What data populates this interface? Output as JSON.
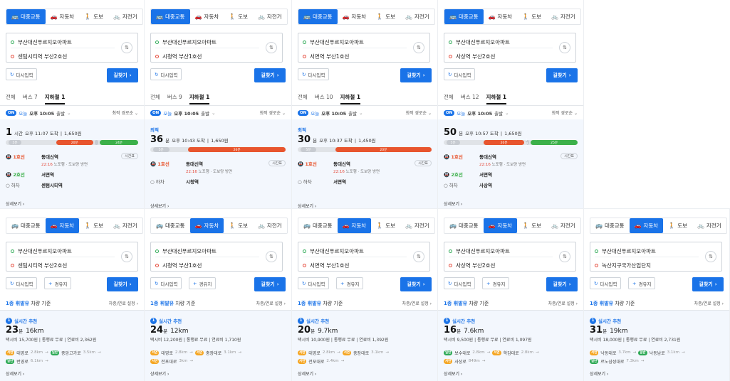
{
  "labels": {
    "tab_transit": "대중교통",
    "tab_car": "자동차",
    "tab_walk": "도보",
    "tab_bike": "자전거",
    "reset": "다시입력",
    "waypoint": "경유지",
    "go": "길찾기",
    "on": "ON",
    "dep_today": "오늘",
    "dep_time": "오후 10:05",
    "dep_suffix": "출발",
    "sort": "최적 경로순",
    "detail": "상세보기",
    "best": "최적",
    "timetable": "시간표",
    "alight": "하차",
    "car_prefix": "1종 휘발유",
    "car_suffix": "차량 기준",
    "car_setting": "차종/연료 설정",
    "realtime": "실시간 추천"
  },
  "origin": "부산대신푸르지오아파트",
  "transit": [
    {
      "dest": "센텀시티역 부산2호선",
      "sub_all": "전체",
      "sub_bus": "버스 7",
      "sub_sub": "지하철 1",
      "best": false,
      "time_num": "1",
      "time_unit": "시간",
      "arrive": "오후 11:07 도착",
      "fare": "1,650원",
      "leg1_line": "1호선",
      "leg1_station": "동대신역",
      "leg1_info": "22:16",
      "leg1_info2": "노포행 · 도보양 방면",
      "leg2_line": "2호선",
      "leg2_station": "서면역",
      "alight_station": "센텀시티역",
      "segs": [
        {
          "l": 0.02,
          "w": 0.1,
          "c": "#c7cbd1",
          "t": "5분"
        },
        {
          "l": 0.38,
          "w": 0.28,
          "c": "#e8552e",
          "t": "20분"
        },
        {
          "l": 0.67,
          "w": 0.03,
          "c": "#c7cbd1",
          "t": ""
        },
        {
          "l": 0.71,
          "w": 0.29,
          "c": "#3cb04a",
          "t": "24분"
        }
      ]
    },
    {
      "dest": "시청역 부산1호선",
      "sub_all": "전체",
      "sub_bus": "버스 9",
      "sub_sub": "지하철 1",
      "best": true,
      "time_num": "36",
      "time_unit": "분",
      "arrive": "오후 10:43 도착",
      "fare": "1,650원",
      "leg1_line": "1호선",
      "leg1_station": "동대신역",
      "leg1_info": "22:16",
      "leg1_info2": "노포행 · 도보양 방면",
      "leg2_line": "",
      "leg2_station": "",
      "alight_station": "시청역",
      "segs": [
        {
          "l": 0.02,
          "w": 0.12,
          "c": "#c7cbd1",
          "t": "5분"
        },
        {
          "l": 0.28,
          "w": 0.72,
          "c": "#e8552e",
          "t": "26분"
        }
      ]
    },
    {
      "dest": "서면역 부산1호선",
      "sub_all": "전체",
      "sub_bus": "버스 10",
      "sub_sub": "지하철 1",
      "best": true,
      "time_num": "30",
      "time_unit": "분",
      "arrive": "오후 10:37 도착",
      "fare": "1,450원",
      "leg1_line": "1호선",
      "leg1_station": "동대신역",
      "leg1_info": "22:16",
      "leg1_info2": "노포행 · 도보양 방면",
      "leg2_line": "",
      "leg2_station": "",
      "alight_station": "서면역",
      "segs": [
        {
          "l": 0.02,
          "w": 0.12,
          "c": "#c7cbd1",
          "t": "5분"
        },
        {
          "l": 0.28,
          "w": 0.72,
          "c": "#e8552e",
          "t": "20분"
        }
      ]
    },
    {
      "dest": "사상역 부산2호선",
      "sub_all": "전체",
      "sub_bus": "버스 12",
      "sub_sub": "지하철 1",
      "best": false,
      "time_num": "50",
      "time_unit": "분",
      "arrive": "오후 10:57 도착",
      "fare": "1,650원",
      "leg1_line": "1호선",
      "leg1_station": "동대신역",
      "leg1_info": "22:16",
      "leg1_info2": "노포행 · 도보양 방면",
      "leg2_line": "2호선",
      "leg2_station": "서면역",
      "alight_station": "사상역",
      "segs": [
        {
          "l": 0.02,
          "w": 0.1,
          "c": "#c7cbd1",
          "t": "5분"
        },
        {
          "l": 0.3,
          "w": 0.3,
          "c": "#e8552e",
          "t": "20분"
        },
        {
          "l": 0.61,
          "w": 0.03,
          "c": "#c7cbd1",
          "t": "1분"
        },
        {
          "l": 0.65,
          "w": 0.35,
          "c": "#3cb04a",
          "t": "25분"
        }
      ]
    }
  ],
  "car": [
    {
      "dest": "센텀시티역 부산2호선",
      "time_num": "23",
      "time_unit": "분",
      "km": "16km",
      "taxi": "택시비 15,700원",
      "toll": "통행료 무료",
      "fuel": "연료비 2,362원",
      "roads": [
        [
          {
            "b": "y",
            "t": "서면",
            "n": "대영로",
            "d": "2.8km"
          },
          {
            "b": "g",
            "t": "일반",
            "n": "중앙고가로",
            "d": "3.5km"
          }
        ],
        [
          {
            "b": "g",
            "t": "일반",
            "n": "번영로",
            "d": "6.1km"
          }
        ]
      ]
    },
    {
      "dest": "시청역 부산1호선",
      "time_num": "24",
      "time_unit": "분",
      "km": "12km",
      "taxi": "택시비 12,200원",
      "toll": "통행료 무료",
      "fuel": "연료비 1,710원",
      "roads": [
        [
          {
            "b": "y",
            "t": "서면",
            "n": "대영로",
            "d": "2.8km"
          },
          {
            "b": "y",
            "t": "서면",
            "n": "충장대로",
            "d": "3.1km"
          }
        ],
        [
          {
            "b": "y",
            "t": "서면",
            "n": "전포대로",
            "d": "3km"
          }
        ]
      ]
    },
    {
      "dest": "서면역 부산1호선",
      "time_num": "20",
      "time_unit": "분",
      "km": "9.7km",
      "taxi": "택시비 10,900원",
      "toll": "통행료 무료",
      "fuel": "연료비 1,392원",
      "roads": [
        [
          {
            "b": "y",
            "t": "서면",
            "n": "대영로",
            "d": "2.8km"
          },
          {
            "b": "y",
            "t": "서면",
            "n": "충장대로",
            "d": "3.1km"
          }
        ],
        [
          {
            "b": "y",
            "t": "서면",
            "n": "전포대로",
            "d": "2.4km"
          }
        ]
      ]
    },
    {
      "dest": "사상역 부산2호선",
      "time_num": "16",
      "time_unit": "분",
      "km": "7.6km",
      "taxi": "택시비 9,500원",
      "toll": "통행료 무료",
      "fuel": "연료비 1,097원",
      "roads": [
        [
          {
            "b": "g",
            "t": "일반",
            "n": "보수대로",
            "d": "2.8km"
          },
          {
            "b": "y",
            "t": "서면",
            "n": "학감대로",
            "d": "2.8km"
          }
        ],
        [
          {
            "b": "y",
            "t": "서면",
            "n": "사상로",
            "d": "849m"
          }
        ]
      ]
    },
    {
      "dest": "녹산지구국가산업단지",
      "time_num": "31",
      "time_unit": "분",
      "km": "19km",
      "taxi": "택시비 18,000원",
      "toll": "통행료 무료",
      "fuel": "연료비 2,731원",
      "roads": [
        [
          {
            "b": "y",
            "t": "서면",
            "n": "낙동대로",
            "d": "3.7km"
          },
          {
            "b": "g",
            "t": "일반",
            "n": "낙동남로",
            "d": "3.1km"
          }
        ],
        [
          {
            "b": "g",
            "t": "일반",
            "n": "르노삼성대로",
            "d": "7.3km"
          }
        ]
      ]
    }
  ],
  "colors": {
    "accent": "#1a73e8",
    "line1": "#e8552e",
    "line2": "#3cb04a"
  },
  "icons": {
    "bus": "bus-icon",
    "car": "car-icon",
    "walk": "walk-icon",
    "bike": "bike-icon",
    "swap": "swap-icon",
    "reset": "refresh-icon",
    "plus": "plus-icon",
    "chevron": "chevron-right-icon",
    "dropdown": "chevron-down-icon"
  }
}
